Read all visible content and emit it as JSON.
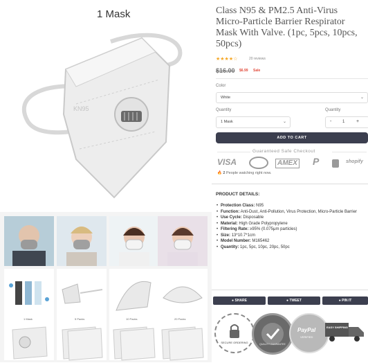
{
  "image_caption": "1 Mask",
  "product": {
    "title": "Class N95 & PM2.5 Anti-Virus Micro-Particle Barrier Respirator Mask With Valve. (1pc, 5pcs, 10pcs, 50pcs)",
    "rating_stars": "★★★★☆",
    "reviews": "20 reviews",
    "price_old": "$16.00",
    "price_new": "$6.99",
    "sale_label": "Sale"
  },
  "options": {
    "color_label": "Color",
    "color_value": "White",
    "quantity_select_label": "Quantity",
    "quantity_select_value": "1 Mask",
    "quantity_stepper_label": "Quantity",
    "quantity_value": "1",
    "minus": "-",
    "plus": "+"
  },
  "cart": {
    "add_label": "ADD TO CART"
  },
  "checkout": {
    "guaranteed_label": "Guaranteed Safe Checkout",
    "payment_icons": [
      "visa-icon",
      "diners-icon",
      "amex-icon",
      "paypal-icon",
      "lock-icon",
      "shopify-icon"
    ],
    "visa": "VISA",
    "amex": "AMEX",
    "paypal": "P",
    "shopify": "shopify"
  },
  "watching": {
    "count": "2",
    "text": "People watching right now."
  },
  "details": {
    "title": "PRODUCT DETAILS:",
    "items": [
      {
        "key": "Protection Class:",
        "value": "N95"
      },
      {
        "key": "Function:",
        "value": "Anti-Dust, Anti-Pollution, Virus Protection, Micro-Particle Barrier"
      },
      {
        "key": "Use Cycle:",
        "value": "Disposable"
      },
      {
        "key": "Material:",
        "value": "High Grade Polypropylene"
      },
      {
        "key": "Filtering Rate:",
        "value": "≥95% (0.075μm particles)"
      },
      {
        "key": "Size:",
        "value": "13*10.7*1cm"
      },
      {
        "key": "Model Number:",
        "value": "M165462"
      },
      {
        "key": "Quantity:",
        "value": "1pc, 5pc, 10pc, 20pc, 50pc"
      }
    ]
  },
  "share": {
    "share": "SHARE",
    "tweet": "TWEET",
    "pin": "PIN IT"
  },
  "trust_badges": {
    "secure_ordering": "SECURE ORDERING",
    "quality": "QUALITY GUARANTEE",
    "paypal": "PayPal",
    "paypal_sub": "VERIFIED",
    "shipping": "EASY SHIPPING"
  },
  "pack_labels": [
    "1 Mask",
    "5 Packs",
    "10 Packs",
    "20 Packs"
  ],
  "colors": {
    "accent": "#3c3f4f",
    "sale": "#e24b3b",
    "star": "#f5a623"
  }
}
